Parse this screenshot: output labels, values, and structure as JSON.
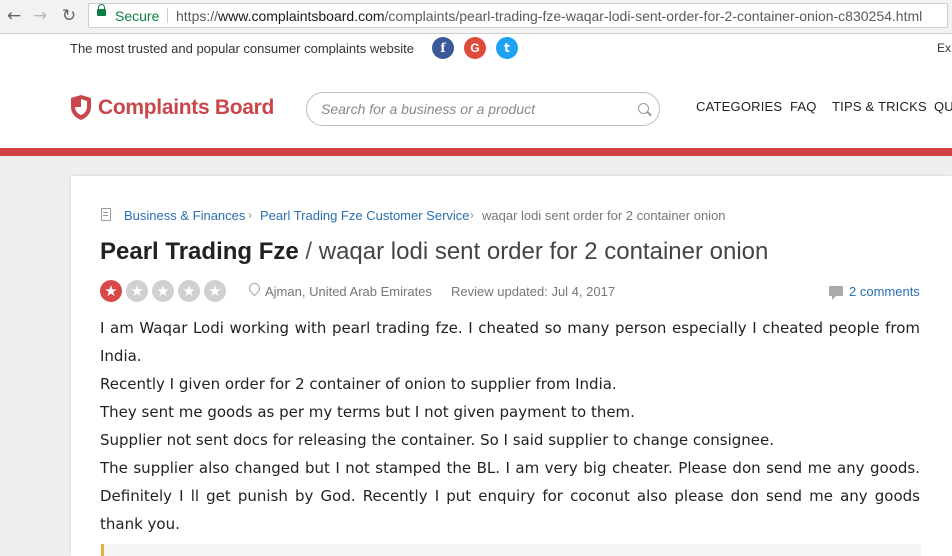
{
  "browser": {
    "secure_label": "Secure",
    "url_scheme": "https://",
    "url_host": "www.complaintsboard.com",
    "url_path": "/complaints/pearl-trading-fze-waqar-lodi-sent-order-for-2-container-onion-c830254.html",
    "back_icon": "back-arrow-icon",
    "forward_icon": "forward-arrow-icon",
    "reload_icon": "reload-icon"
  },
  "topstrip": {
    "tagline": "The most trusted and popular consumer complaints website",
    "social": [
      "f",
      "G",
      "t"
    ],
    "right_text": "Ex"
  },
  "header": {
    "logo_text": "Complaints Board",
    "search_placeholder": "Search for a business or a product",
    "menu": [
      "CATEGORIES",
      "FAQ",
      "TIPS & TRICKS",
      "QU"
    ],
    "accent_color": "#cd4346"
  },
  "breadcrumb": [
    "Business & Finances",
    "Pearl Trading Fze Customer Service",
    "waqar lodi sent order for 2 container onion"
  ],
  "complaint": {
    "company": "Pearl Trading Fze",
    "separator": " / ",
    "subject": "waqar lodi sent order for 2 container onion",
    "rating": 1,
    "rating_max": 5,
    "location": "Ajman, United Arab Emirates",
    "updated": "Review updated: Jul 4, 2017",
    "comments": "2 comments",
    "paragraphs": [
      "I am Waqar Lodi working with pearl trading fze. I cheated so many person especially I cheated people from India.",
      "Recently I given order for 2 container of onion to supplier from India.",
      "They sent me goods as per my terms but I not given payment to them.",
      "Supplier not sent docs for releasing the container. So I said supplier to change consignee.",
      "The supplier also changed but I not stamped the BL. I am very big cheater. Please don send me any goods. Definitely I ll get punish by God. Recently I put enquiry for coconut also please don send me any goods thank you."
    ]
  }
}
